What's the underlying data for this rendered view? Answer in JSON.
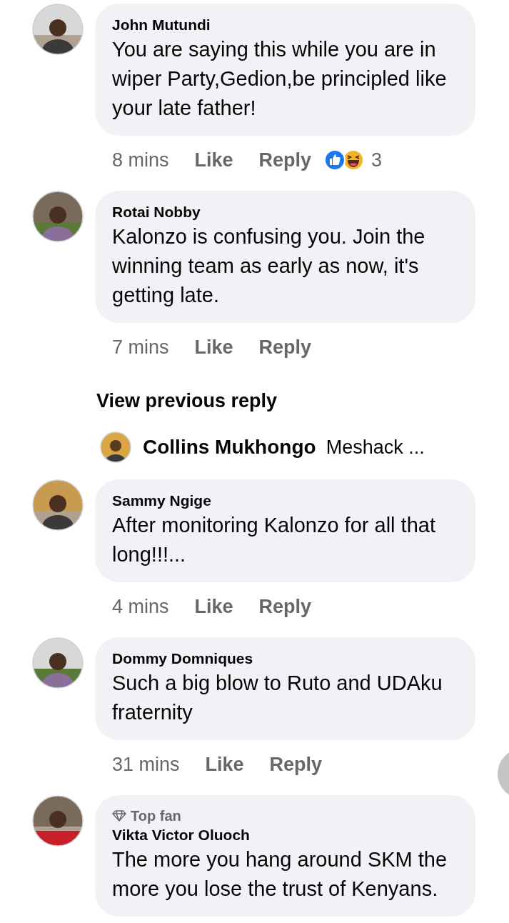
{
  "comments": [
    {
      "kind": "comment",
      "author": "John Mutundi",
      "text": "You are saying this while you are in wiper Party,Gedion,be principled like your late father!",
      "time": "8 mins",
      "like": "Like",
      "reply": "Reply",
      "reactions": [
        {
          "kind": "like"
        },
        {
          "kind": "haha"
        }
      ],
      "reaction_count": "3"
    },
    {
      "kind": "comment",
      "author": "Rotai Nobby",
      "text": "Kalonzo is confusing you. Join the winning team as early as now, it's getting late.",
      "time": "7 mins",
      "like": "Like",
      "reply": "Reply"
    },
    {
      "kind": "view_previous",
      "label": "View previous reply"
    },
    {
      "kind": "reply_preview",
      "author": "Collins Mukhongo",
      "text": "Meshack ..."
    },
    {
      "kind": "comment",
      "author": "Sammy Ngige",
      "text": "After monitoring Kalonzo for all that long!!!...",
      "time": "4 mins",
      "like": "Like",
      "reply": "Reply"
    },
    {
      "kind": "comment",
      "author": "Dommy Domniques",
      "text": "Such a big blow to Ruto and UDAku fraternity",
      "time": "31 mins",
      "like": "Like",
      "reply": "Reply"
    },
    {
      "kind": "comment",
      "badge": "Top fan",
      "author": "Vikta Victor Oluoch",
      "text": "The more you hang around SKM the more you lose the trust of Kenyans."
    }
  ]
}
